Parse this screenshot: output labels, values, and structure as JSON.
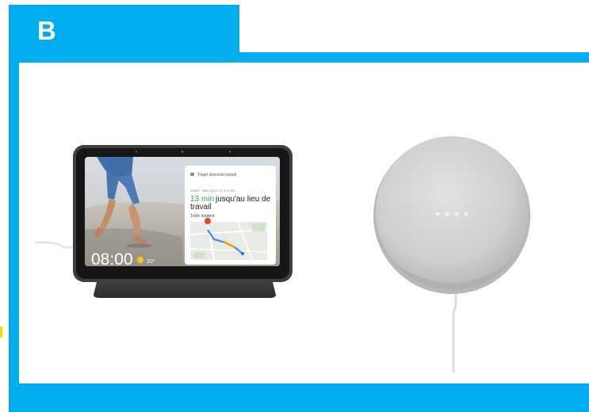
{
  "panel": {
    "label": "B"
  },
  "hub_screen": {
    "card_header": "Trajet domicile-travail",
    "card_sub": "Julien · Mis à jour il y a 1 min",
    "eta": "13 min",
    "eta_rest": "jusqu'au lieu de",
    "destination": "travail",
    "traffic": "Trafic modéré",
    "clock": "08:00",
    "temp": "20°"
  },
  "colors": {
    "accent": "#00adef",
    "hub_body": "#3e3f41",
    "eta_green": "#34a853",
    "route_blue": "#4285f4",
    "route_orange": "#f29900",
    "pin_red": "#ea4335",
    "speaker_fabric": "#cfcfcf",
    "speaker_led": "#f2f2f2"
  }
}
